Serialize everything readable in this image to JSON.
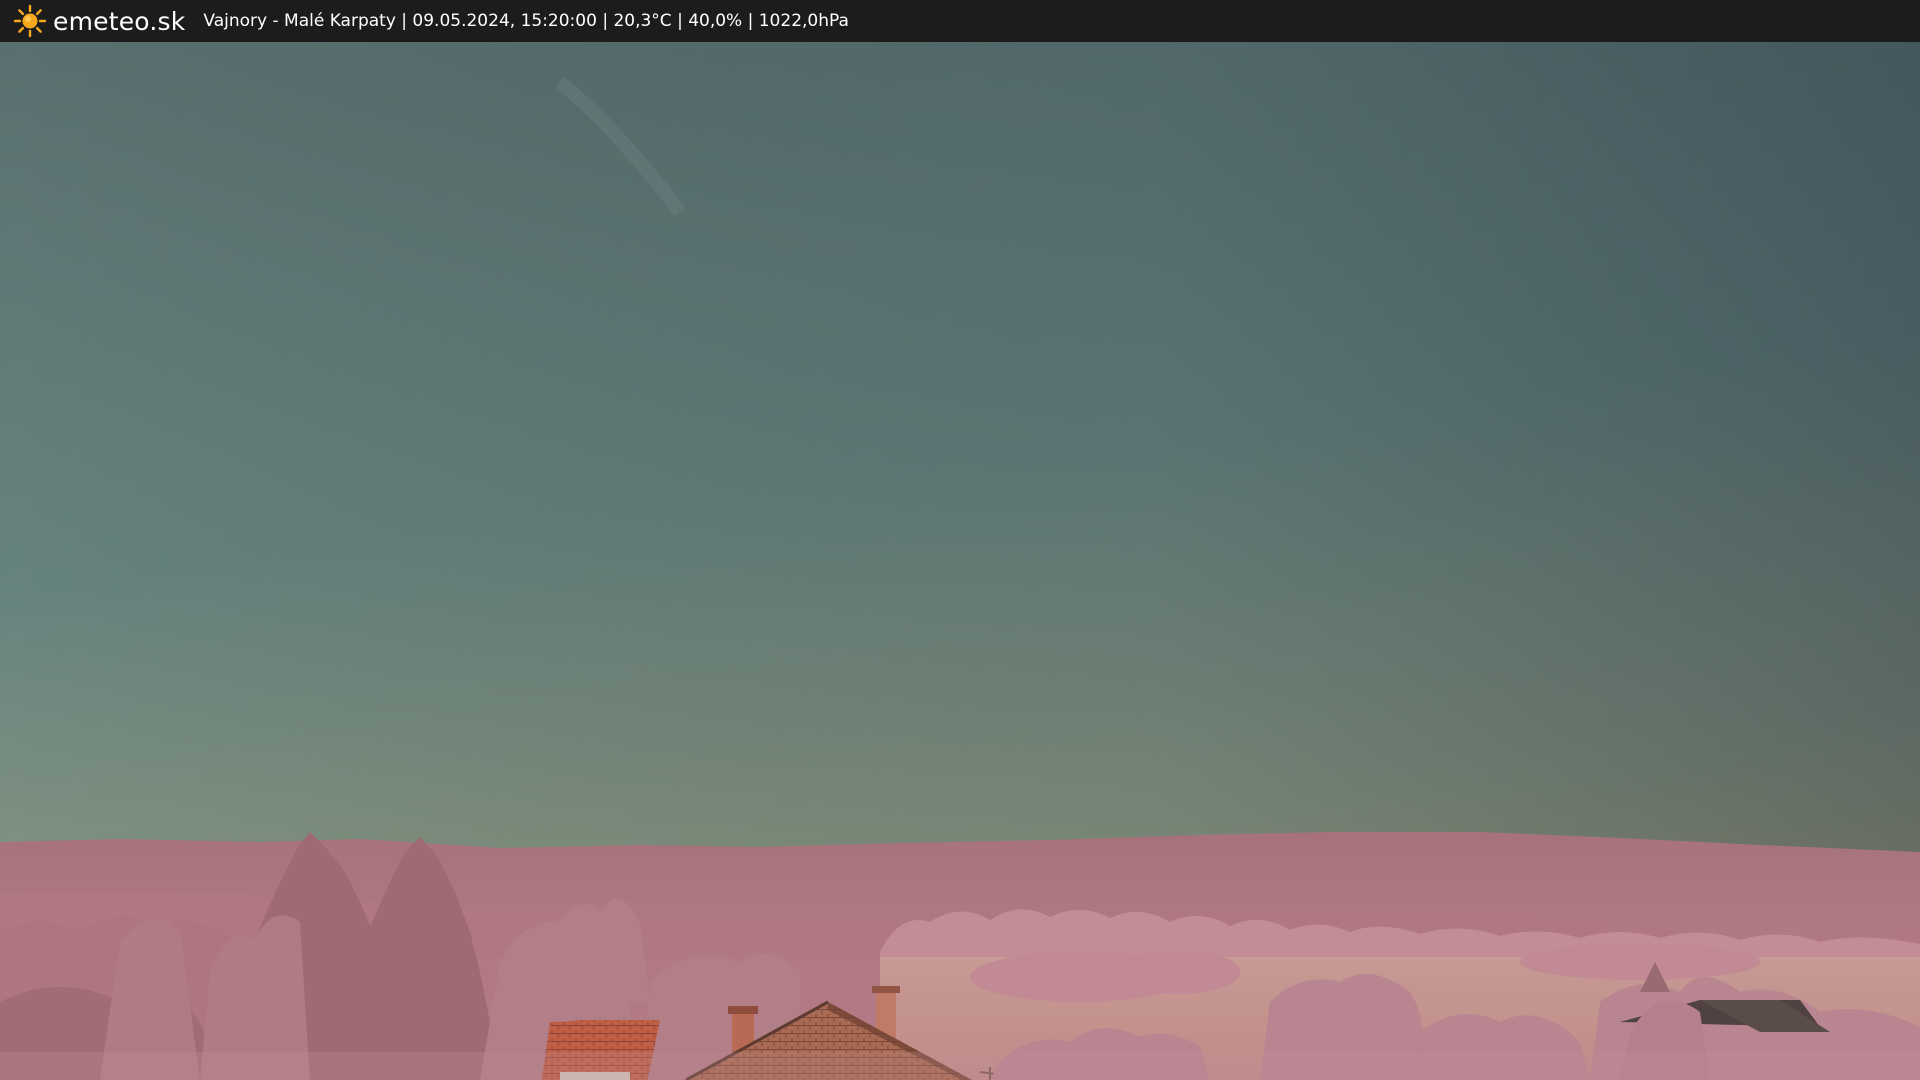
{
  "brand": {
    "logo_icon": "sun-icon",
    "name": "emeteo.sk"
  },
  "caption": "Vajnory - Malé Karpaty | 09.05.2024, 15:20:00 | 20,3°C | 40,0% | 1022,0hPa",
  "colors": {
    "bar_background": "#1c1c1c",
    "sun": "#f6a91c",
    "sky_top": "#3e5260",
    "sky_horizon": "#9a9e7f",
    "foliage": "#b87d86",
    "field": "#c4948f",
    "roof": "#b5593f"
  }
}
